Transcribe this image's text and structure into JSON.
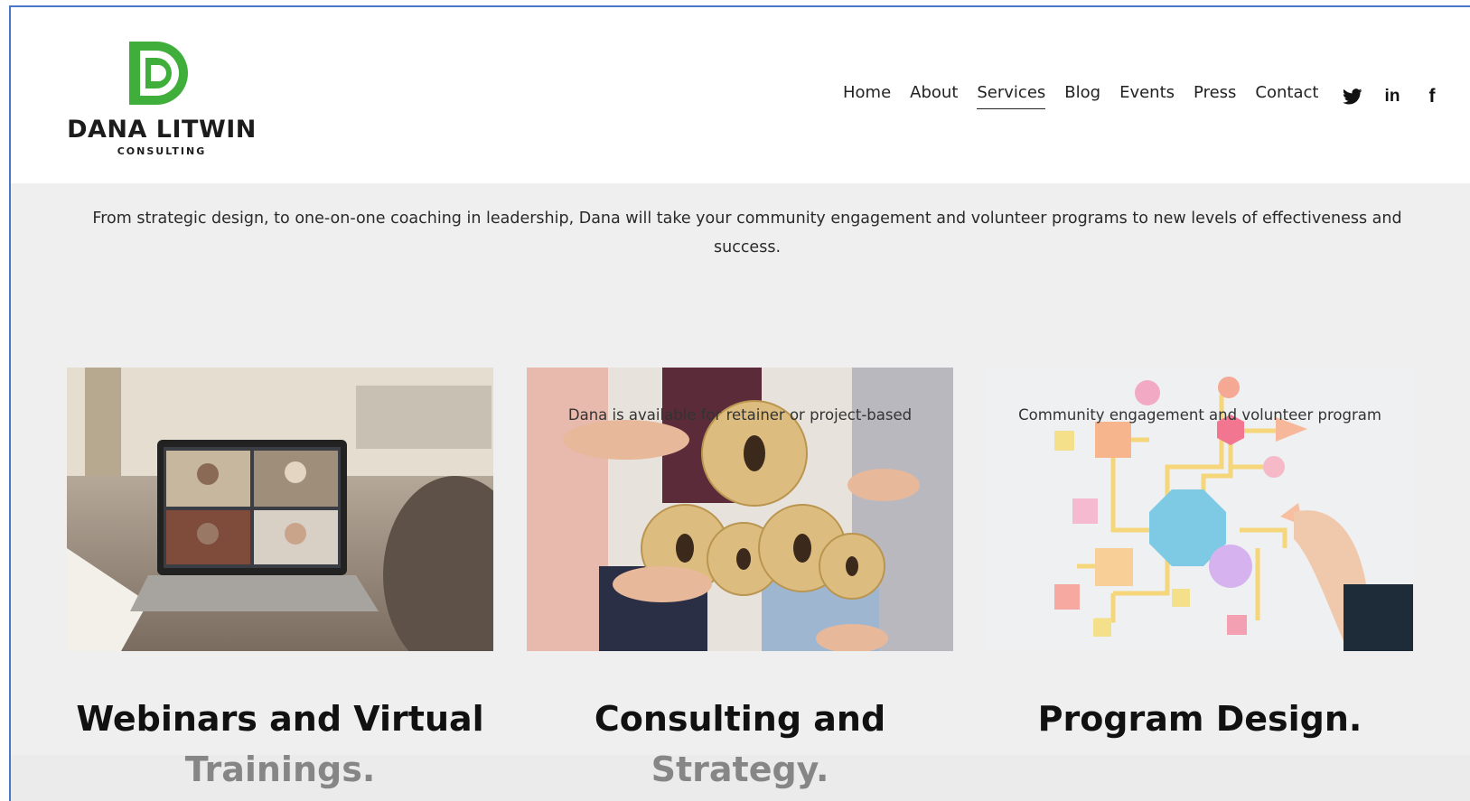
{
  "brand": {
    "name": "DANA LITWIN",
    "tagline": "CONSULTING",
    "accent_color": "#3fae3a"
  },
  "nav": {
    "items": [
      {
        "label": "Home"
      },
      {
        "label": "About"
      },
      {
        "label": "Services",
        "active": true
      },
      {
        "label": "Blog"
      },
      {
        "label": "Events"
      },
      {
        "label": "Press"
      },
      {
        "label": "Contact"
      }
    ]
  },
  "social": {
    "icons": [
      "twitter-icon",
      "linkedin-icon",
      "facebook-icon"
    ],
    "linkedin_glyph": "in",
    "facebook_glyph": "f"
  },
  "intro": {
    "text": "From strategic design, to one-on-one coaching in leadership, Dana will take your community engagement and volunteer programs to new levels of effectiveness and success."
  },
  "services": [
    {
      "title": "Webinars and Virtual Trainings.",
      "description": "",
      "image": "video-call-laptop-photo"
    },
    {
      "title": "Consulting and Strategy.",
      "description": "Dana is available for retainer or project-based",
      "image": "hands-gears-teamwork-photo"
    },
    {
      "title": "Program Design.",
      "description": "Community engagement and volunteer program",
      "image": "flowchart-shapes-photo"
    }
  ]
}
